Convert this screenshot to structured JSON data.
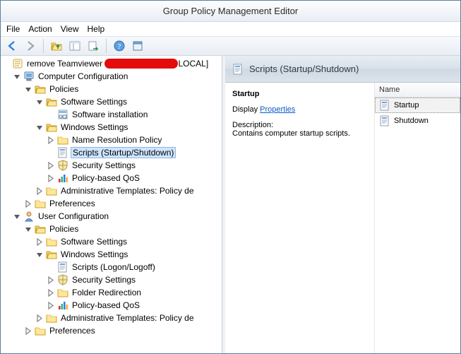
{
  "title": "Group Policy Management Editor",
  "menu": {
    "file": "File",
    "action": "Action",
    "view": "View",
    "help": "Help"
  },
  "tree": {
    "root": {
      "label_prefix": "remove Teamviewer ",
      "label_suffix": "LOCAL]"
    },
    "computer_config": "Computer Configuration",
    "policies": "Policies",
    "software_settings": "Software Settings",
    "software_installation": "Software installation",
    "windows_settings": "Windows Settings",
    "name_res_policy": "Name Resolution Policy",
    "scripts_startup": "Scripts (Startup/Shutdown)",
    "security_settings": "Security Settings",
    "policy_qos": "Policy-based QoS",
    "admin_templates": "Administrative Templates: Policy de",
    "preferences": "Preferences",
    "user_config": "User Configuration",
    "scripts_logon": "Scripts (Logon/Logoff)",
    "folder_redirection": "Folder Redirection"
  },
  "detail": {
    "header": "Scripts (Startup/Shutdown)",
    "selected": "Startup",
    "display_label": "Display",
    "properties_link": "Properties",
    "description_label": "Description:",
    "description_text": "Contains computer startup scripts.",
    "col_name": "Name",
    "items": {
      "startup": "Startup",
      "shutdown": "Shutdown"
    }
  }
}
